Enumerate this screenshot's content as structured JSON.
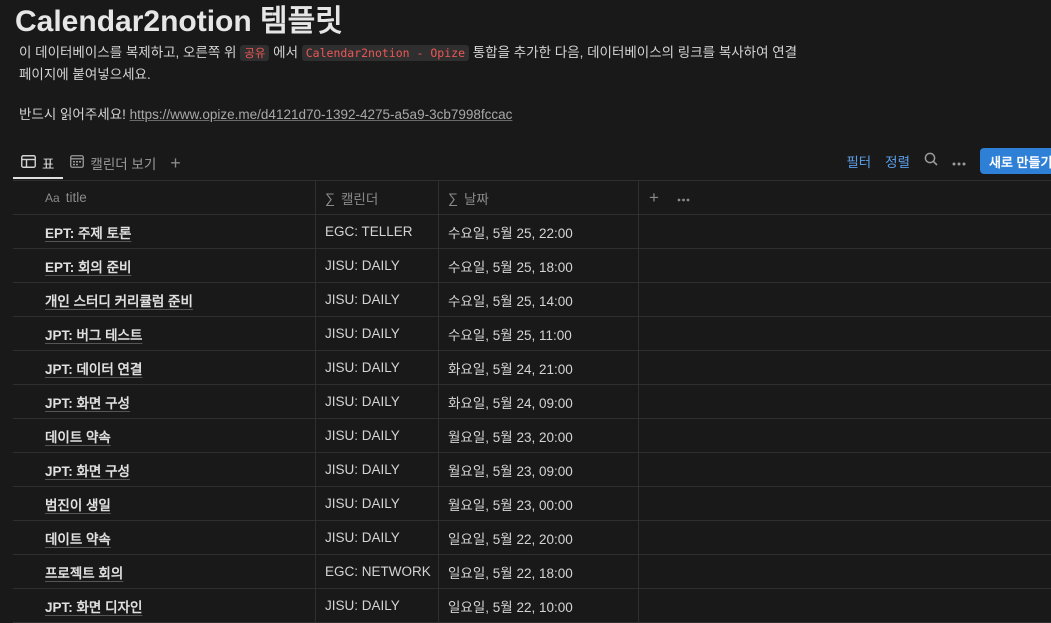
{
  "page": {
    "title": "Calendar2notion 템플릿",
    "desc_part1": "이 데이터베이스를 복제하고, 오른쪽 위 ",
    "code_share": "공유",
    "desc_part2": " 에서 ",
    "code_integration": "Calendar2notion - Opize",
    "desc_part3": " 통합을 추가한 다음, 데이터베이스의 링크를 복사하여 연결",
    "desc_line2": "페이지에 붙여넣으세요.",
    "notice_label": "반드시 읽어주세요! ",
    "notice_link": "https://www.opize.me/d4121d70-1392-4275-a5a9-3cb7998fccac"
  },
  "tabs": [
    {
      "label": "표",
      "icon": "table-icon"
    },
    {
      "label": "캘린더 보기",
      "icon": "calendar-icon"
    }
  ],
  "toolbar": {
    "filter": "필터",
    "sort": "정렬",
    "new_label": "새로 만들기"
  },
  "columns": {
    "title": "title",
    "title_prefix": "Aa",
    "calendar": "캘린더",
    "date": "날짜",
    "sigma": "∑"
  },
  "rows": [
    {
      "title": "EPT: 주제 토론",
      "calendar": "EGC: TELLER",
      "date": "수요일, 5월 25, 22:00"
    },
    {
      "title": "EPT: 회의 준비",
      "calendar": "JISU: DAILY",
      "date": "수요일, 5월 25, 18:00"
    },
    {
      "title": "개인 스터디 커리큘럼 준비",
      "calendar": "JISU: DAILY",
      "date": "수요일, 5월 25, 14:00"
    },
    {
      "title": "JPT: 버그 테스트",
      "calendar": "JISU: DAILY",
      "date": "수요일, 5월 25, 11:00"
    },
    {
      "title": "JPT: 데이터 연결",
      "calendar": "JISU: DAILY",
      "date": "화요일, 5월 24, 21:00"
    },
    {
      "title": "JPT: 화면 구성",
      "calendar": "JISU: DAILY",
      "date": "화요일, 5월 24, 09:00"
    },
    {
      "title": "데이트 약속",
      "calendar": "JISU: DAILY",
      "date": "월요일, 5월 23, 20:00"
    },
    {
      "title": "JPT: 화면 구성",
      "calendar": "JISU: DAILY",
      "date": "월요일, 5월 23, 09:00"
    },
    {
      "title": "범진이 생일",
      "calendar": "JISU: DAILY",
      "date": "월요일, 5월 23, 00:00"
    },
    {
      "title": "데이트 약속",
      "calendar": "JISU: DAILY",
      "date": "일요일, 5월 22, 20:00"
    },
    {
      "title": "프로젝트 회의",
      "calendar": "EGC: NETWORK",
      "date": "일요일, 5월 22, 18:00"
    },
    {
      "title": "JPT: 화면 디자인",
      "calendar": "JISU: DAILY",
      "date": "일요일, 5월 22, 10:00"
    }
  ],
  "colors": {
    "background": "#191919",
    "accent": "#2e7fd6",
    "link": "#5a9ee8",
    "code": "#eb5757"
  }
}
